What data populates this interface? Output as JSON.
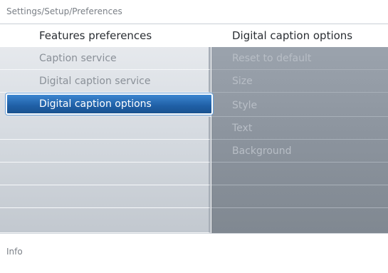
{
  "breadcrumb": "Settings/Setup/Preferences",
  "header": {
    "left_title": "Features preferences",
    "right_title": "Digital caption options"
  },
  "menu": {
    "items": [
      {
        "label": "Caption service"
      },
      {
        "label": "Digital caption service"
      },
      {
        "label": "Digital caption options",
        "selected": true
      },
      {
        "label": ""
      },
      {
        "label": ""
      },
      {
        "label": ""
      },
      {
        "label": ""
      },
      {
        "label": ""
      }
    ]
  },
  "options": {
    "items": [
      {
        "label": "Reset to default"
      },
      {
        "label": "Size"
      },
      {
        "label": "Style"
      },
      {
        "label": "Text"
      },
      {
        "label": "Background"
      },
      {
        "label": ""
      },
      {
        "label": ""
      },
      {
        "label": ""
      }
    ]
  },
  "info": "Info",
  "colors": {
    "selection": "#1f5fa6",
    "left_panel": "#d6dbe1",
    "right_panel": "#8b939d"
  }
}
